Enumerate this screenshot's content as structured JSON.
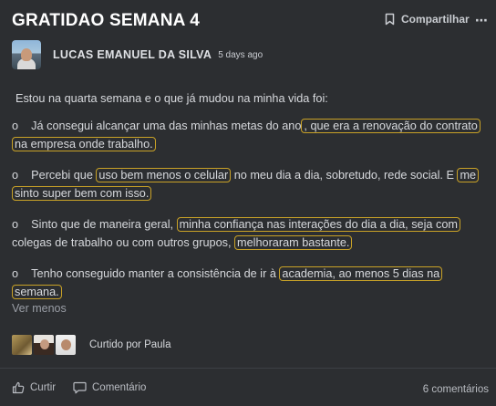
{
  "post": {
    "title": "GRATIDAO SEMANA 4",
    "share_label": "Compartilhar",
    "more_label": "⋯",
    "author": "LUCAS EMANUEL DA SILVA",
    "time": "5 days ago",
    "intro": "Estou na quarta semana e o que já mudou na minha vida foi:",
    "items": [
      {
        "bullet": "o",
        "t1": "Já consegui alcançar uma das minhas metas do ano",
        "h1": ", que era a renovação do contrato na empresa onde trabalho."
      },
      {
        "bullet": "o",
        "t1": "Percebi que ",
        "h1": "uso bem menos o celular",
        "t2": " no meu dia a dia, sobretudo, rede social. E ",
        "h2": "me sinto super bem com isso."
      },
      {
        "bullet": "o",
        "t1": "Sinto que de maneira geral, ",
        "h1": "minha confiança nas interações do dia a dia, seja com",
        "t2": " colegas de trabalho ou com outros grupos, ",
        "h2": "melhoraram bastante."
      },
      {
        "bullet": "o",
        "t1": "Tenho conseguido manter a consistência de ir à ",
        "h1": "academia, ao menos 5 dias na semana."
      }
    ],
    "see_less": "Ver menos",
    "liked_by": "Curtido por Paula",
    "like_label": "Curtir",
    "comment_label": "Comentário",
    "comments_count": "6 comentários"
  },
  "colors": {
    "background": "#2c2e31",
    "highlight_border": "#c9a227",
    "text": "#d7d9dd"
  },
  "icons": {
    "share": "bookmark-icon",
    "more": "more-icon",
    "like": "thumbs-up-icon",
    "comment": "comment-icon"
  }
}
